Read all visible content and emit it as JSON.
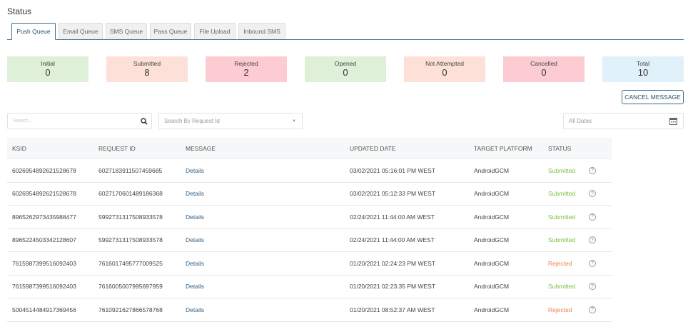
{
  "title": "Status",
  "tabs": [
    "Push Queue",
    "Email Queue",
    "SMS Queue",
    "Pass Queue",
    "File Upload",
    "Inbound SMS"
  ],
  "cards": [
    {
      "label": "Initial",
      "value": "0",
      "color": "#dff0d8"
    },
    {
      "label": "Submitted",
      "value": "8",
      "color": "#fde1d8"
    },
    {
      "label": "Rejected",
      "value": "2",
      "color": "#fdccd2"
    },
    {
      "label": "Opened",
      "value": "0",
      "color": "#dff0d8"
    },
    {
      "label": "Not Attempted",
      "value": "0",
      "color": "#fde1d8"
    },
    {
      "label": "Cancelled",
      "value": "0",
      "color": "#fdccd2"
    },
    {
      "label": "Total",
      "value": "10",
      "color": "#e1f1f9"
    }
  ],
  "cancel_label": "CANCEL MESSAGE",
  "search_placeholder": "Search...",
  "request_placeholder": "Search By Request Id",
  "dates_placeholder": "All Dates",
  "columns": [
    "KSID",
    "REQUEST ID",
    "MESSAGE",
    "UPDATED DATE",
    "TARGET PLATFORM",
    "STATUS"
  ],
  "rows": [
    [
      "6026954892621528678",
      "6027183911507459685",
      "Details",
      "03/02/2021 05:16:01 PM WEST",
      "AndroidGCM",
      "Submitted"
    ],
    [
      "6026954892621528678",
      "6027170601489186368",
      "Details",
      "03/02/2021 05:12:33 PM WEST",
      "AndroidGCM",
      "Submitted"
    ],
    [
      "8965262973435988477",
      "5992731317508933578",
      "Details",
      "02/24/2021 11:44:00 AM WEST",
      "AndroidGCM",
      "Submitted"
    ],
    [
      "8965224503342128607",
      "5992731317508933578",
      "Details",
      "02/24/2021 11:44:00 AM WEST",
      "AndroidGCM",
      "Submitted"
    ],
    [
      "7615987399516092403",
      "7616017495777009525",
      "Details",
      "01/20/2021 02:24:23 PM WEST",
      "AndroidGCM",
      "Rejected"
    ],
    [
      "7615987399516092403",
      "7616005007995697959",
      "Details",
      "01/20/2021 02:23:35 PM WEST",
      "AndroidGCM",
      "Submitted"
    ],
    [
      "5004514484917369456",
      "7610921627866578768",
      "Details",
      "01/20/2021 08:52:37 AM WEST",
      "AndroidGCM",
      "Rejected"
    ]
  ]
}
